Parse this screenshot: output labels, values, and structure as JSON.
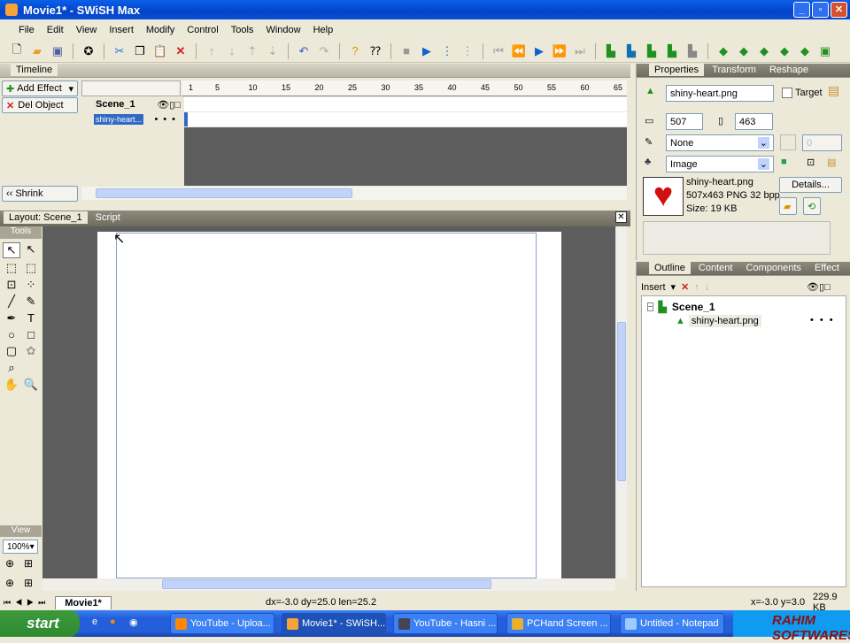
{
  "window": {
    "title": "Movie1* - SWiSH Max"
  },
  "menu": [
    "File",
    "Edit",
    "View",
    "Insert",
    "Modify",
    "Control",
    "Tools",
    "Window",
    "Help"
  ],
  "timeline": {
    "tab": "Timeline",
    "add_effect": "Add Effect",
    "del_object": "Del Object",
    "shrink": "Shrink",
    "ruler": [
      "1",
      "5",
      "10",
      "15",
      "20",
      "25",
      "30",
      "35",
      "40",
      "45",
      "50",
      "55",
      "60",
      "65"
    ],
    "scene": "Scene_1",
    "object": "shiny-heart..."
  },
  "layout": {
    "tabs": [
      "Layout: Scene_1",
      "Script"
    ],
    "tools_label": "Tools",
    "view_label": "View",
    "zoom": "100%"
  },
  "bottom": {
    "movie_tab": "Movie1*",
    "status": "dx=-3.0 dy=25.0 len=25.2",
    "coords": "x=-3.0 y=3.0",
    "size": "229.9 KB"
  },
  "properties": {
    "tabs": [
      "Properties",
      "Transform",
      "Reshape"
    ],
    "name": "shiny-heart.png",
    "target": "Target",
    "width": "507",
    "height": "463",
    "line": "None",
    "fill": "Image",
    "line_width": "0",
    "image_name": "shiny-heart.png",
    "image_info": "507x463 PNG 32 bpp",
    "image_size": "Size: 19 KB",
    "details": "Details..."
  },
  "outline": {
    "tabs": [
      "Outline",
      "Content",
      "Components",
      "Effect"
    ],
    "insert": "Insert",
    "scene": "Scene_1",
    "object": "shiny-heart.png"
  },
  "taskbar": {
    "start": "start",
    "tasks": [
      "YouTube - Uploa...",
      "Movie1* - SWiSH...",
      "YouTube - Hasni ...",
      "PCHand Screen ...",
      "Untitled - Notepad"
    ],
    "watermark": "RAHIM SOFTWARES"
  }
}
